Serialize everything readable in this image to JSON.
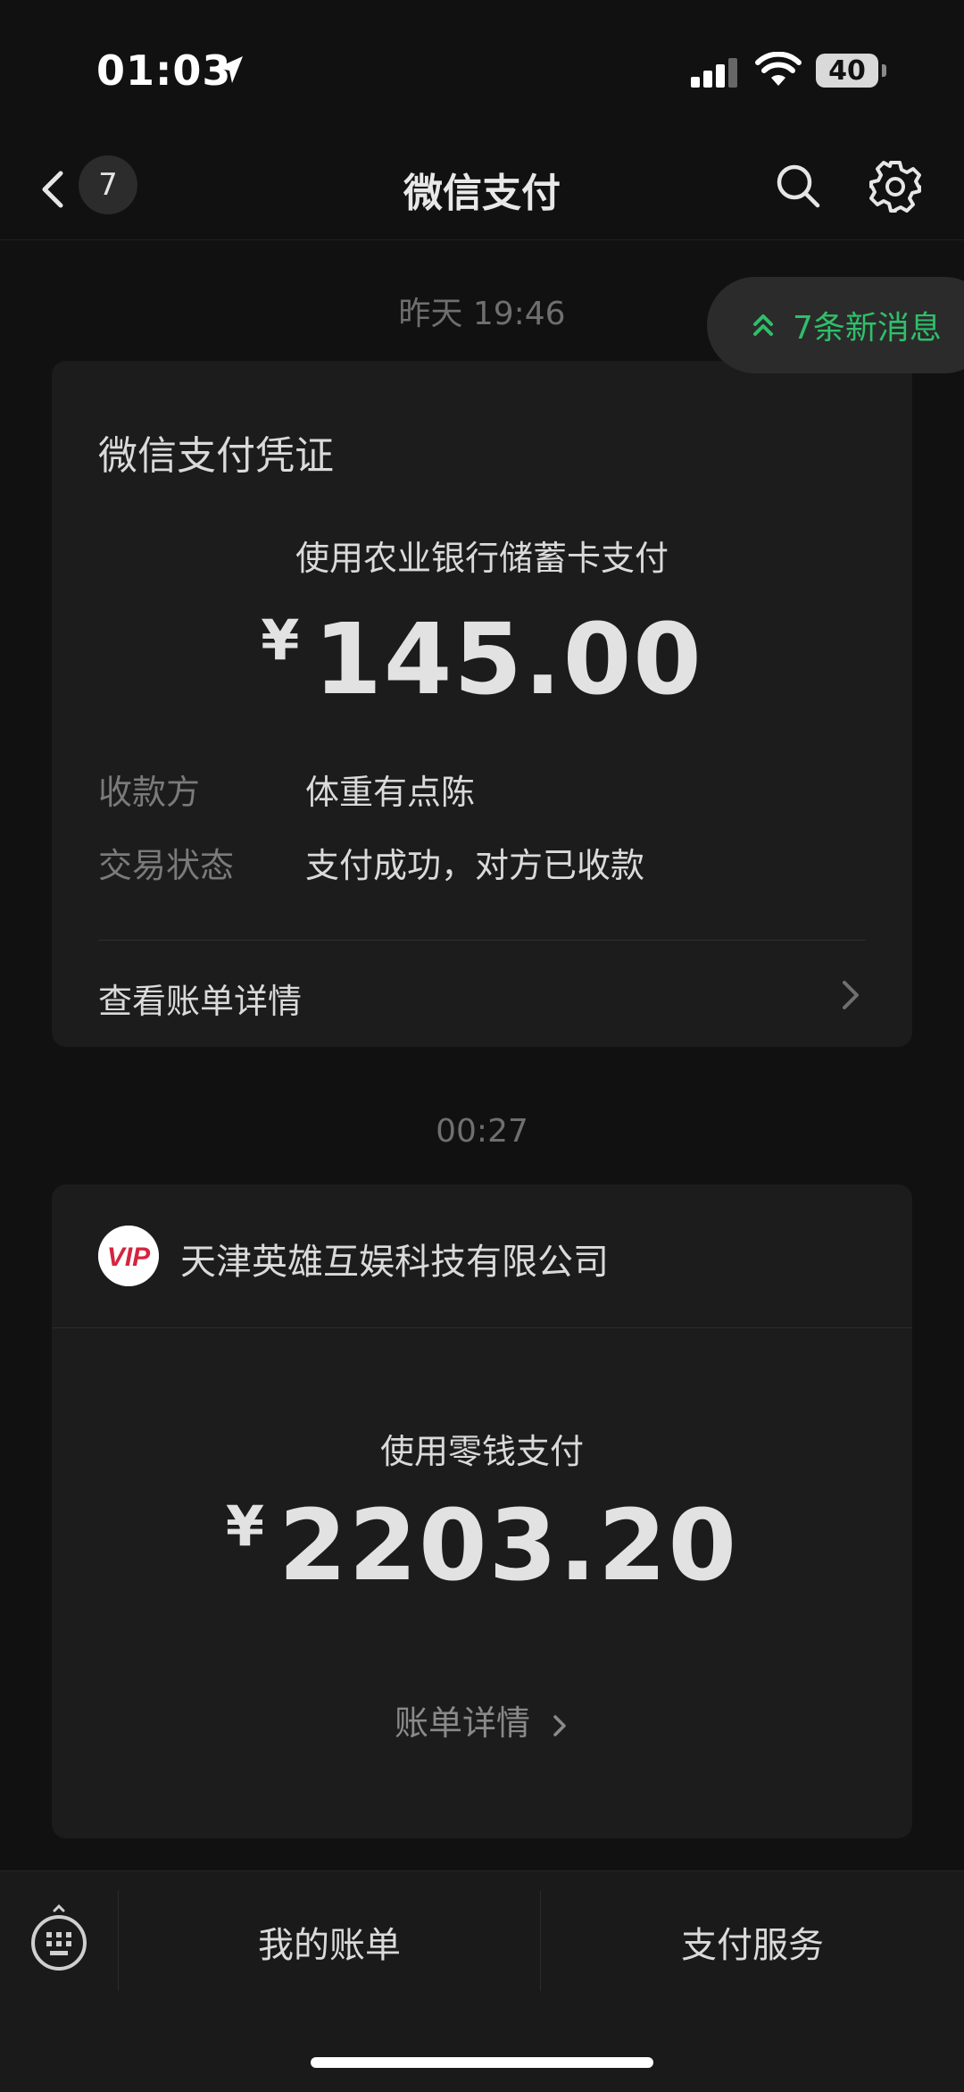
{
  "status_bar": {
    "time": "01:03",
    "battery": "40"
  },
  "nav": {
    "back_badge": "7",
    "title": "微信支付"
  },
  "new_messages": {
    "label": "7条新消息",
    "color": "#2fbf6a"
  },
  "messages": [
    {
      "timestamp": "昨天 19:46",
      "title": "微信支付凭证",
      "pay_method": "使用农业银行储蓄卡支付",
      "currency": "¥",
      "amount": "145.00",
      "fields": [
        {
          "label": "收款方",
          "value": "体重有点陈"
        },
        {
          "label": "交易状态",
          "value": "支付成功，对方已收款"
        }
      ],
      "detail_link": "查看账单详情"
    },
    {
      "timestamp": "00:27",
      "merchant_logo_text": "VIP",
      "merchant": "天津英雄互娱科技有限公司",
      "pay_method": "使用零钱支付",
      "currency": "¥",
      "amount": "2203.20",
      "detail_link": "账单详情"
    }
  ],
  "bottom_bar": {
    "items": [
      "我的账单",
      "支付服务"
    ]
  }
}
